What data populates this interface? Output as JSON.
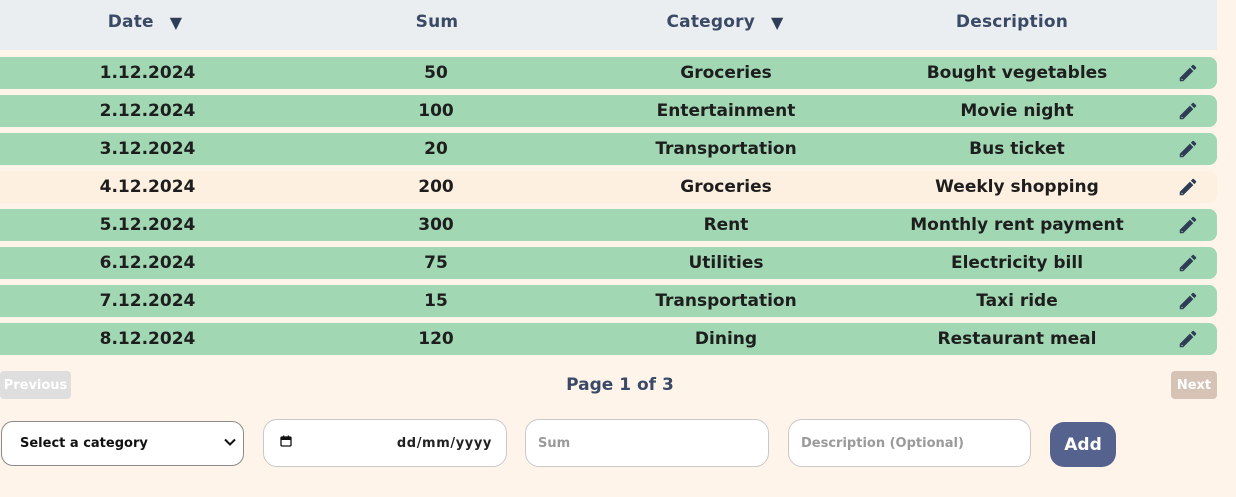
{
  "table": {
    "headers": {
      "date": "Date",
      "sum": "Sum",
      "category": "Category",
      "description": "Description",
      "sort_icon": "caret-down-icon"
    },
    "rows": [
      {
        "date": "1.12.2024",
        "sum": "50",
        "category": "Groceries",
        "description": "Bought vegetables"
      },
      {
        "date": "2.12.2024",
        "sum": "100",
        "category": "Entertainment",
        "description": "Movie night"
      },
      {
        "date": "3.12.2024",
        "sum": "20",
        "category": "Transportation",
        "description": "Bus ticket"
      },
      {
        "date": "4.12.2024",
        "sum": "200",
        "category": "Groceries",
        "description": "Weekly shopping"
      },
      {
        "date": "5.12.2024",
        "sum": "300",
        "category": "Rent",
        "description": "Monthly rent payment"
      },
      {
        "date": "6.12.2024",
        "sum": "75",
        "category": "Utilities",
        "description": "Electricity bill"
      },
      {
        "date": "7.12.2024",
        "sum": "15",
        "category": "Transportation",
        "description": "Taxi ride"
      },
      {
        "date": "8.12.2024",
        "sum": "120",
        "category": "Dining",
        "description": "Restaurant meal"
      }
    ],
    "row_icon": "pencil-edit-icon"
  },
  "pagination": {
    "previous_label": "Previous",
    "page_info": "Page 1 of 3",
    "next_label": "Next"
  },
  "form": {
    "category_select": "Select a category",
    "date_placeholder": "dd/mm/yyyy",
    "sum_placeholder": "Sum",
    "description_placeholder": "Description (Optional)",
    "add_label": "Add"
  },
  "colors": {
    "page_bg": "#fef4ea",
    "header_bg": "#ebeef0",
    "row_green": "#a1d8b3",
    "row_highlight": "#fdf0e0",
    "header_text": "#3a4a66",
    "add_button": "#56628e"
  }
}
